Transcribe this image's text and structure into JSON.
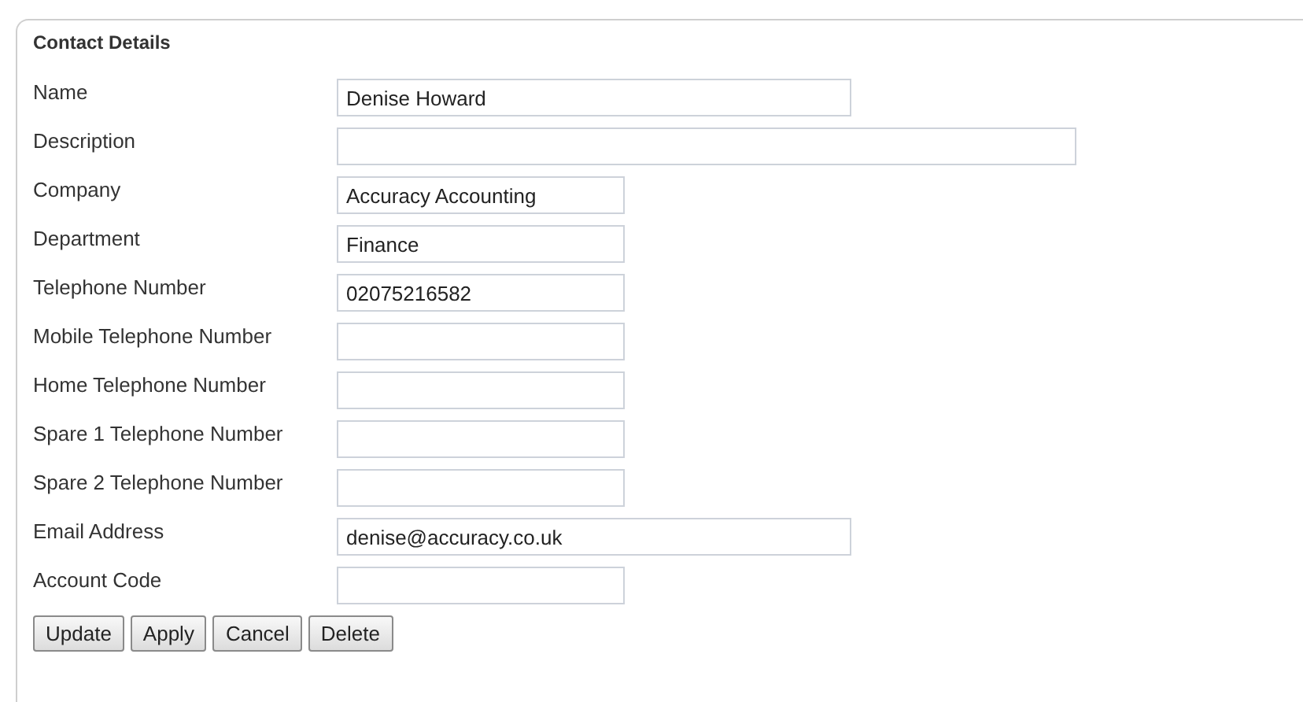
{
  "panel": {
    "title": "Contact Details"
  },
  "fields": [
    {
      "label": "Name",
      "value": "Denise Howard",
      "kind": "medium"
    },
    {
      "label": "Description",
      "kind": "long"
    },
    {
      "label": "Company",
      "value": "Accuracy Accounting",
      "kind": "short"
    },
    {
      "label": "Department",
      "value": "Finance",
      "kind": "short"
    },
    {
      "label": "Telephone Number",
      "value": "02075216582",
      "kind": "short"
    },
    {
      "label": "Mobile Telephone Number",
      "kind": "short"
    },
    {
      "label": "Home Telephone Number",
      "kind": "short"
    },
    {
      "label": "Spare 1 Telephone Number",
      "kind": "short"
    },
    {
      "label": "Spare 2 Telephone Number",
      "kind": "short"
    },
    {
      "label": "Email Address",
      "value": "denise@accuracy.co.uk",
      "kind": "medium"
    },
    {
      "label": "Account Code",
      "kind": "short"
    }
  ],
  "buttons": [
    "Update",
    "Apply",
    "Cancel",
    "Delete"
  ]
}
